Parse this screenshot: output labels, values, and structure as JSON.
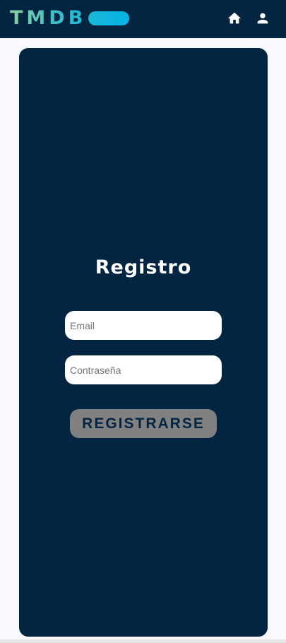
{
  "navbar": {
    "logo_text": "TMDB",
    "icons": [
      "home-icon",
      "user-icon"
    ]
  },
  "form": {
    "title": "Registro",
    "email_placeholder": "Email",
    "password_placeholder": "Contraseña",
    "submit_label": "REGISTRARSE"
  },
  "colors": {
    "navbar_bg": "#032541",
    "card_bg": "#032541",
    "page_bg": "#f8f8fd",
    "logo_gradient_start": "#90cea1",
    "logo_gradient_end": "#01b4e4",
    "button_bg": "#808080",
    "button_text": "#032541"
  }
}
